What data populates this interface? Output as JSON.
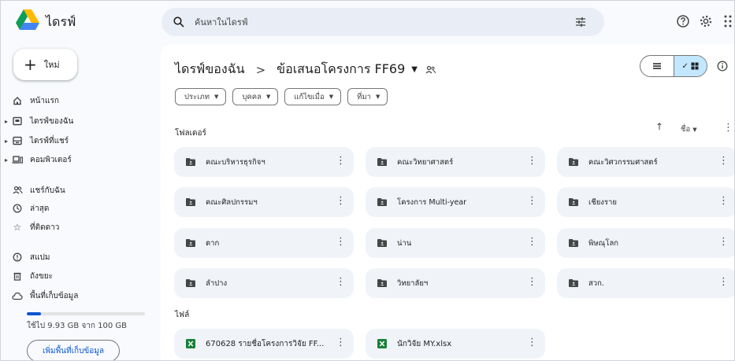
{
  "app": {
    "title": "ไดรฟ์",
    "new_label": "ใหม่"
  },
  "sidebar": {
    "items": [
      {
        "label": "หน้าแรก"
      },
      {
        "label": "ไดรฟ์ของฉัน"
      },
      {
        "label": "ไดรฟ์ที่แชร์"
      },
      {
        "label": "คอมพิวเตอร์"
      },
      {
        "label": "แชร์กับฉัน"
      },
      {
        "label": "ล่าสุด"
      },
      {
        "label": "ที่ติดดาว"
      },
      {
        "label": "สแปม"
      },
      {
        "label": "ถังขยะ"
      },
      {
        "label": "พื้นที่เก็บข้อมูล"
      }
    ],
    "storage": {
      "used_fraction": 0.0993,
      "text": "ใช้ไป 9.93 GB จาก 100 GB",
      "button": "เพิ่มพื้นที่เก็บข้อมูล"
    }
  },
  "search": {
    "placeholder": "ค้นหาในไดรฟ์"
  },
  "breadcrumb": {
    "root": "ไดรฟ์ของฉัน",
    "separator": ">",
    "current": "ข้อเสนอโครงการ FF69"
  },
  "filters": [
    {
      "label": "ประเภท"
    },
    {
      "label": "บุคคล"
    },
    {
      "label": "แก้ไขเมื่อ"
    },
    {
      "label": "ที่มา"
    }
  ],
  "sections": {
    "folders": "โฟลเดอร์",
    "files": "ไฟล์",
    "sort_label": "ชื่อ"
  },
  "folders": [
    {
      "name": "คณะบริหารธุรกิจฯ"
    },
    {
      "name": "คณะวิทยาศาสตร์"
    },
    {
      "name": "คณะวิศวกรรมศาสตร์"
    },
    {
      "name": "คณะศิลปกรรมฯ"
    },
    {
      "name": "โครงการ Multi-year"
    },
    {
      "name": "เชียงราย"
    },
    {
      "name": "ตาก"
    },
    {
      "name": "น่าน"
    },
    {
      "name": "พิษณุโลก"
    },
    {
      "name": "ลำปาง"
    },
    {
      "name": "วิทยาลัยฯ"
    },
    {
      "name": "สวก."
    }
  ],
  "files": [
    {
      "name": "670628 รายชื่อโครงการวิจัย FF..."
    },
    {
      "name": "นักวิจัย MY.xlsx"
    }
  ],
  "colors": {
    "accent": "#0b57d0",
    "sheets_green": "#188038",
    "selected_view": "#c2e7ff"
  }
}
